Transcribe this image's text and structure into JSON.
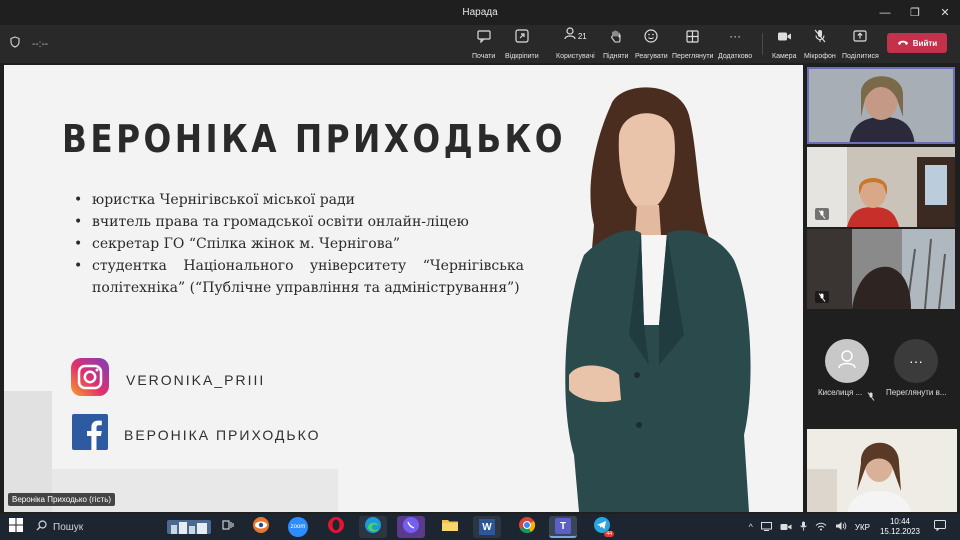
{
  "window": {
    "title": "Нарада"
  },
  "toolbar": {
    "timer": "--:--",
    "participants_count": "21",
    "buttons": {
      "chat": "Почати",
      "open": "Відкріпити",
      "people": "Користувачі",
      "raise": "Підняти",
      "react": "Реагувати",
      "view": "Переглянути",
      "more": "Додатково",
      "camera": "Камера",
      "mic": "Мікрофон",
      "share": "Поділитися"
    },
    "leave_label": "Вийти"
  },
  "slide": {
    "name": "ВЕРОНІКА ПРИХОДЬКО",
    "bullets": [
      "юристка Чернігівської міської ради",
      "вчитель права та громадської освіти онлайн-ліцею",
      "секретар ГО “Спілка жінок м. Чернігова”",
      "студентка Національного університету “Чернігівська політехніка” (“Публічне управління та адміністрування”)"
    ],
    "instagram": "VERONIKA_PRIII",
    "facebook": "ВЕРОНІКА ПРИХОДЬКО"
  },
  "presenter_tag": "Вероніка Приходько (гість)",
  "participants": {
    "kiselytsia": "Киселиця ...",
    "view_all": "Переглянути в..."
  },
  "taskbar": {
    "search_placeholder": "Пошук",
    "lang": "УКР",
    "time": "10:44",
    "date": "15.12.2023",
    "zoom_label": "zoom",
    "telegram_badge": "44"
  },
  "colors": {
    "leave": "#c4314b",
    "toolbar": "#292929",
    "accent": "#6264a7"
  }
}
